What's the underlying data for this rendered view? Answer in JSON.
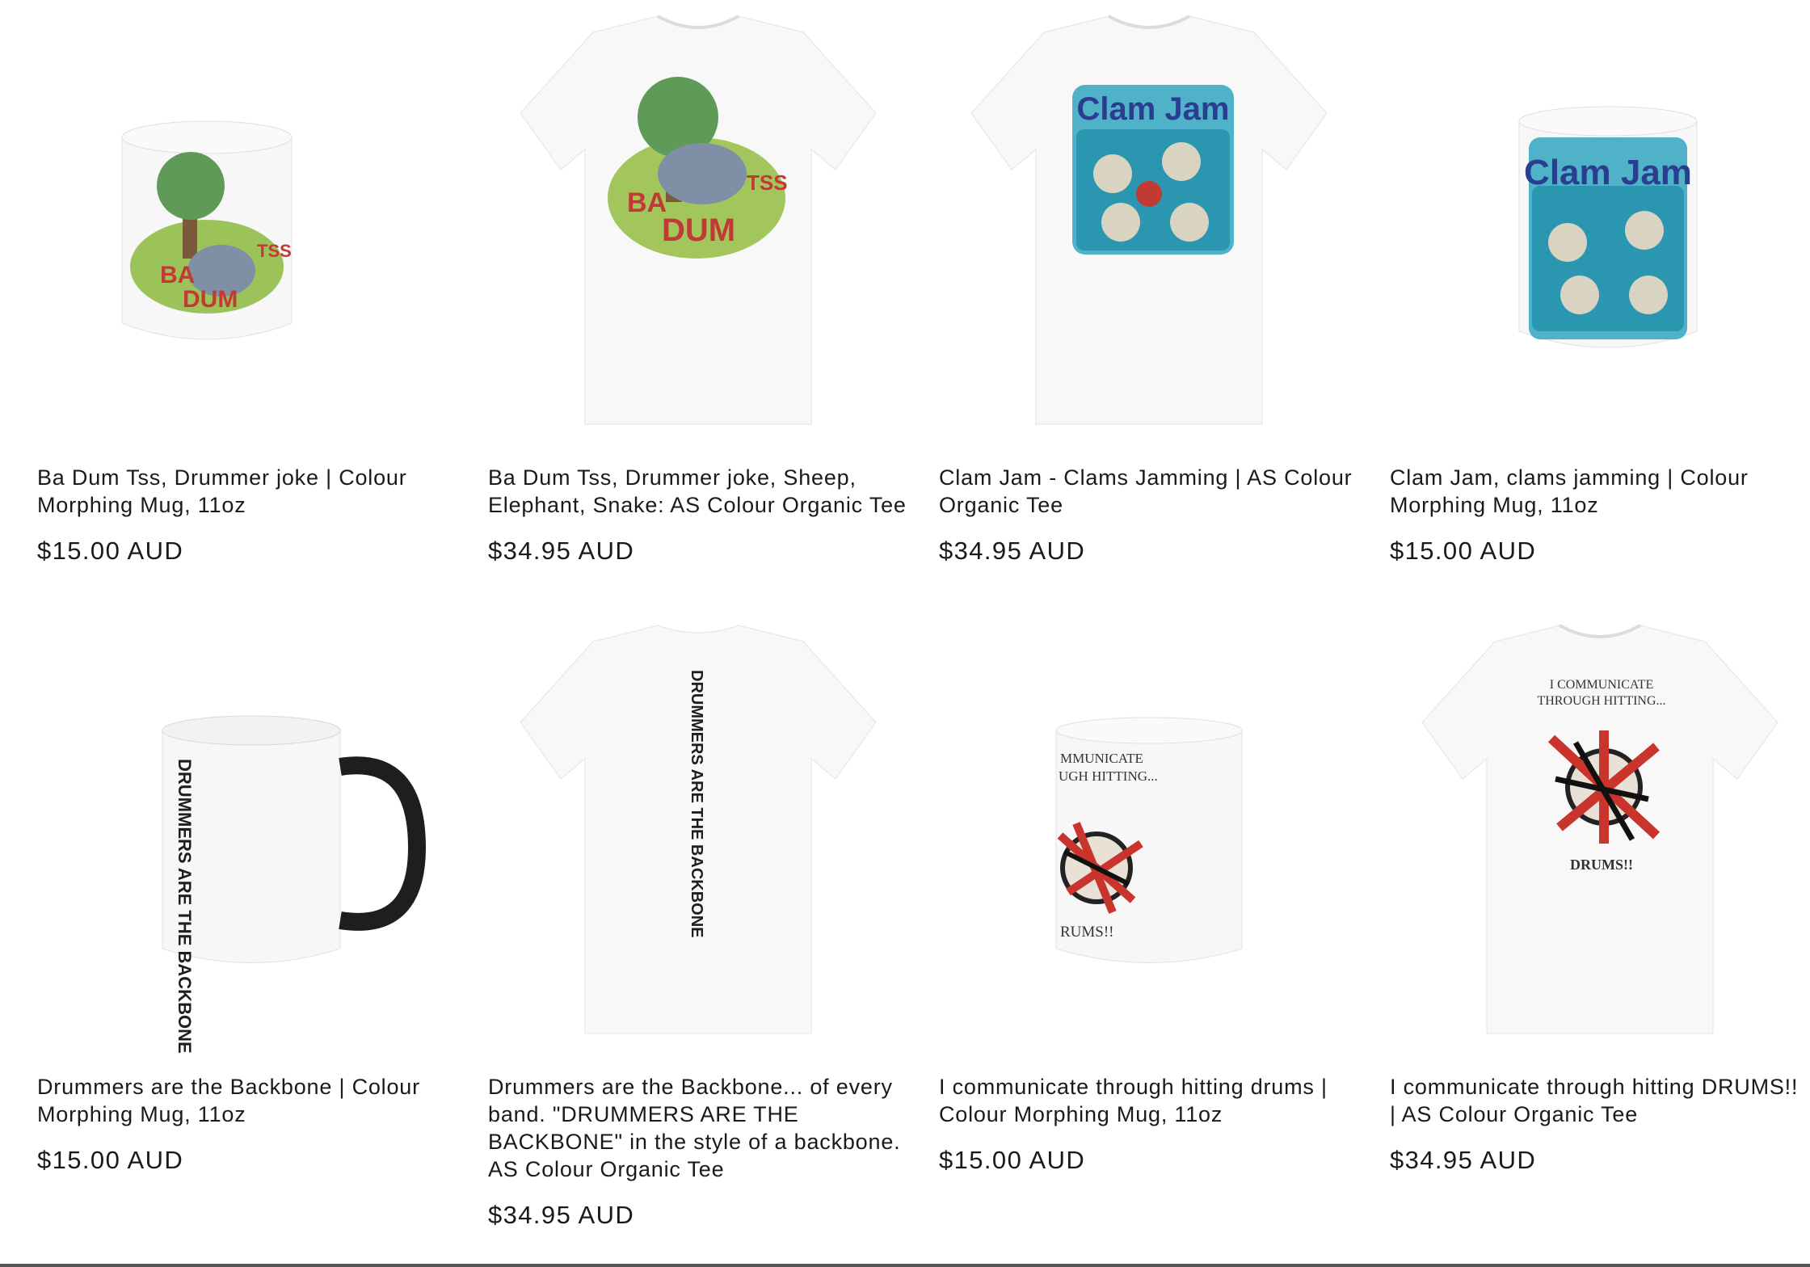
{
  "products": [
    {
      "title": "Ba Dum Tss, Drummer joke | Colour Morphing Mug, 11oz",
      "price": "$15.00 AUD",
      "image": "ba-dum-tss-mug",
      "print_text": [
        "BA",
        "DUM",
        "TSS"
      ]
    },
    {
      "title": "Ba Dum Tss, Drummer joke, Sheep, Elephant, Snake: AS Colour Organic Tee",
      "price": "$34.95 AUD",
      "image": "ba-dum-tss-tee",
      "print_text": [
        "BA",
        "DUM",
        "TSS"
      ]
    },
    {
      "title": "Clam Jam - Clams Jamming | AS Colour Organic Tee",
      "price": "$34.95 AUD",
      "image": "clam-jam-tee",
      "print_text": [
        "Clam Jam"
      ]
    },
    {
      "title": "Clam Jam, clams jamming | Colour Morphing Mug, 11oz",
      "price": "$15.00 AUD",
      "image": "clam-jam-mug",
      "print_text": [
        "Clam Jam"
      ]
    },
    {
      "title": "Drummers are the Backbone | Colour Morphing Mug, 11oz",
      "price": "$15.00 AUD",
      "image": "backbone-mug",
      "print_text": [
        "DRUMMERS ARE THE BACKBONE"
      ]
    },
    {
      "title": "Drummers are the Backbone... of every band. \"DRUMMERS ARE THE BACKBONE\" in the style of a backbone. AS Colour Organic Tee",
      "price": "$34.95 AUD",
      "image": "backbone-tee",
      "print_text": [
        "DRUMMERS ARE THE BACKBONE"
      ]
    },
    {
      "title": "I communicate through hitting drums | Colour Morphing Mug, 11oz",
      "price": "$15.00 AUD",
      "image": "communicate-mug",
      "print_text": [
        "MMUNICATE",
        "UGH HITTING...",
        "RUMS!!"
      ]
    },
    {
      "title": "I communicate through hitting DRUMS!! | AS Colour Organic Tee",
      "price": "$34.95 AUD",
      "image": "communicate-tee",
      "print_text": [
        "I COMMUNICATE",
        "THROUGH HITTING...",
        "DRUMS!!"
      ]
    }
  ]
}
